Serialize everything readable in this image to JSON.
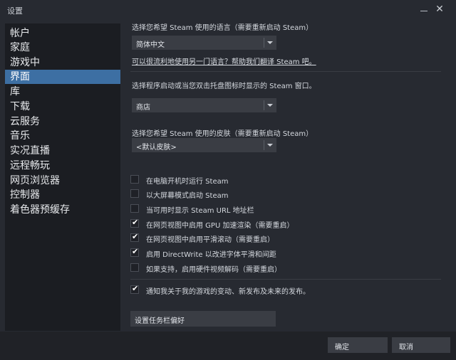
{
  "window": {
    "title": "设置",
    "close_glyph": "✕"
  },
  "sidebar": {
    "items": [
      {
        "label": "帐户"
      },
      {
        "label": "家庭"
      },
      {
        "label": "游戏中"
      },
      {
        "label": "界面",
        "active": true
      },
      {
        "label": "库"
      },
      {
        "label": "下载"
      },
      {
        "label": "云服务"
      },
      {
        "label": "音乐"
      },
      {
        "label": "实况直播"
      },
      {
        "label": "远程畅玩"
      },
      {
        "label": "网页浏览器"
      },
      {
        "label": "控制器"
      },
      {
        "label": "着色器预缓存"
      }
    ]
  },
  "interface": {
    "language_label": "选择您希望 Steam 使用的语言（需要重新启动 Steam）",
    "language_value": "简体中文",
    "translate_link": "可以很流利地使用另一门语言？帮助我们翻译 Steam 吧。",
    "startup_label": "选择程序启动或当您双击托盘图标时显示的 Steam 窗口。",
    "startup_value": "商店",
    "skin_label": "选择您希望 Steam 使用的皮肤（需要重新启动 Steam）",
    "skin_value": "<默认皮肤>",
    "checkboxes": [
      {
        "label": "在电脑开机时运行 Steam",
        "checked": false
      },
      {
        "label": "以大屏幕模式启动 Steam",
        "checked": false
      },
      {
        "label": "当可用时显示 Steam URL 地址栏",
        "checked": false
      },
      {
        "label": "在网页视图中启用 GPU 加速渲染（需要重启）",
        "checked": true
      },
      {
        "label": "在网页视图中启用平滑滚动（需要重启）",
        "checked": true
      },
      {
        "label": "启用 DirectWrite 以改进字体平滑和间距",
        "checked": true
      },
      {
        "label": "如果支持，启用硬件视频解码（需要重启）",
        "checked": false
      }
    ],
    "notify": {
      "label": "通知我关于我的游戏的变动、新发布及未来的发布。",
      "checked": true
    },
    "taskbar_button": "设置任务栏偏好"
  },
  "footer": {
    "ok_label": "确定",
    "cancel_label": "取消"
  },
  "colors": {
    "accent": "#3d6fa3",
    "background": "#272a31",
    "sidebar": "#1b1d22"
  },
  "icons": {
    "check": "✔"
  }
}
